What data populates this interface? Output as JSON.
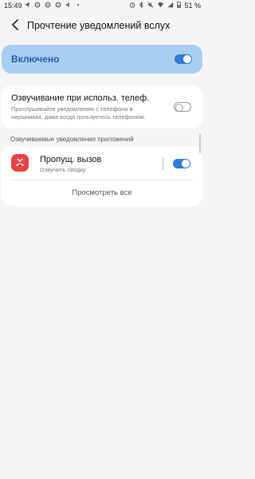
{
  "status_bar": {
    "time": "15:49",
    "battery": "51 %"
  },
  "header": {
    "title": "Прочтение уведомлений вслух"
  },
  "master_switch": {
    "label": "Включено",
    "state": "on"
  },
  "phone_use": {
    "title": "Озвучивание при использ. телеф.",
    "description": "Прослушивайте уведомления с телефона в наушниках, даже когда пользуетесь телефоном.",
    "state": "off"
  },
  "apps_section": {
    "header": "Озвучиваемые уведомления приложений",
    "apps": [
      {
        "name": "Пропущ. вызов",
        "subtitle": "Озвучить сводку",
        "icon": "missed-call-icon",
        "icon_color": "#e64545",
        "state": "on"
      }
    ],
    "view_all_label": "Просмотреть все"
  },
  "colors": {
    "accent": "#2f7bd8",
    "master_card_bg": "#a9ceef",
    "master_label": "#1a5fb0",
    "background": "#f5f5f5"
  }
}
